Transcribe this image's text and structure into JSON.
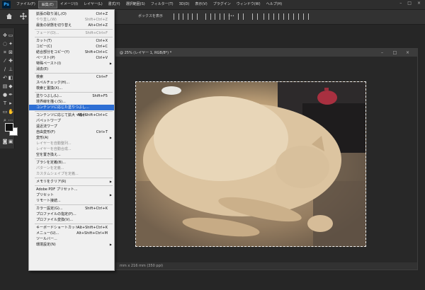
{
  "app": {
    "logo_text": "Ps",
    "accent": "#31a8ff"
  },
  "menubar": {
    "items": [
      "ファイル(F)",
      "編集(E)",
      "イメージ(I)",
      "レイヤー(L)",
      "書式(Y)",
      "選択範囲(S)",
      "フィルター(T)",
      "3D(D)",
      "表示(V)",
      "プラグイン",
      "ウィンドウ(W)",
      "ヘルプ(H)"
    ],
    "active_index": 1
  },
  "options_bar": {
    "label": "ボックスを表示"
  },
  "document": {
    "tab_title": "@ 25% (レイヤー 1, RGB/8*) *",
    "status_text": "mm x 216 mm (350 ppi)",
    "controls": [
      "minimize-icon",
      "maximize-icon",
      "close-icon"
    ]
  },
  "edit_menu": {
    "highlight_color": "#2e6fd4",
    "items": [
      {
        "type": "item",
        "label": "拡張の取り消し(O)",
        "shortcut": "Ctrl+Z",
        "disabled": false
      },
      {
        "type": "item",
        "label": "やり直し(W)",
        "shortcut": "Shift+Ctrl+Z",
        "disabled": true
      },
      {
        "type": "item",
        "label": "最後の状態を切り替え",
        "shortcut": "Alt+Ctrl+Z",
        "disabled": false
      },
      {
        "type": "sep"
      },
      {
        "type": "item",
        "label": "フェード(D)...",
        "shortcut": "Shift+Ctrl+F",
        "disabled": true
      },
      {
        "type": "sep"
      },
      {
        "type": "item",
        "label": "カット(T)",
        "shortcut": "Ctrl+X",
        "disabled": false
      },
      {
        "type": "item",
        "label": "コピー(C)",
        "shortcut": "Ctrl+C",
        "disabled": false
      },
      {
        "type": "item",
        "label": "結合部分をコピー(Y)",
        "shortcut": "Shift+Ctrl+C",
        "disabled": false
      },
      {
        "type": "item",
        "label": "ペースト(P)",
        "shortcut": "Ctrl+V",
        "disabled": false
      },
      {
        "type": "item",
        "label": "特殊ペースト(I)",
        "shortcut": "",
        "submenu": true,
        "disabled": false
      },
      {
        "type": "item",
        "label": "消去(E)",
        "shortcut": "",
        "disabled": false
      },
      {
        "type": "sep"
      },
      {
        "type": "item",
        "label": "検索",
        "shortcut": "Ctrl+F",
        "disabled": false
      },
      {
        "type": "item",
        "label": "スペルチェック(H)...",
        "shortcut": "",
        "disabled": false
      },
      {
        "type": "item",
        "label": "検索と置換(X)...",
        "shortcut": "",
        "disabled": false
      },
      {
        "type": "sep"
      },
      {
        "type": "item",
        "label": "塗りつぶし(L)...",
        "shortcut": "Shift+F5",
        "disabled": false
      },
      {
        "type": "item",
        "label": "境界線を描く(S)...",
        "shortcut": "",
        "disabled": false
      },
      {
        "type": "item",
        "label": "コンテンツに応じた塗りつぶし...",
        "shortcut": "",
        "disabled": false,
        "highlighted": true
      },
      {
        "type": "sep"
      },
      {
        "type": "item",
        "label": "コンテンツに応じて拡大・縮小",
        "shortcut": "Alt+Shift+Ctrl+C",
        "disabled": false
      },
      {
        "type": "item",
        "label": "パペットワープ",
        "shortcut": "",
        "disabled": false
      },
      {
        "type": "item",
        "label": "遠近法ワープ",
        "shortcut": "",
        "disabled": false
      },
      {
        "type": "item",
        "label": "自由変形(F)",
        "shortcut": "Ctrl+T",
        "disabled": false
      },
      {
        "type": "item",
        "label": "変形(A)",
        "shortcut": "",
        "submenu": true,
        "disabled": false
      },
      {
        "type": "item",
        "label": "レイヤーを自動整列...",
        "shortcut": "",
        "disabled": true
      },
      {
        "type": "item",
        "label": "レイヤーを自動合成...",
        "shortcut": "",
        "disabled": true
      },
      {
        "type": "item",
        "label": "空を置き換え...",
        "shortcut": "",
        "disabled": false
      },
      {
        "type": "sep"
      },
      {
        "type": "item",
        "label": "ブラシを定義(B)...",
        "shortcut": "",
        "disabled": false
      },
      {
        "type": "item",
        "label": "パターンを定義...",
        "shortcut": "",
        "disabled": true
      },
      {
        "type": "item",
        "label": "カスタムシェイプを定義...",
        "shortcut": "",
        "disabled": true
      },
      {
        "type": "sep"
      },
      {
        "type": "item",
        "label": "メモリをクリア(R)",
        "shortcut": "",
        "submenu": true,
        "disabled": false
      },
      {
        "type": "sep"
      },
      {
        "type": "item",
        "label": "Adobe PDF プリセット...",
        "shortcut": "",
        "disabled": false
      },
      {
        "type": "item",
        "label": "プリセット",
        "shortcut": "",
        "submenu": true,
        "disabled": false
      },
      {
        "type": "item",
        "label": "リモート接続...",
        "shortcut": "",
        "disabled": false
      },
      {
        "type": "sep"
      },
      {
        "type": "item",
        "label": "カラー設定(G)...",
        "shortcut": "Shift+Ctrl+K",
        "disabled": false
      },
      {
        "type": "item",
        "label": "プロファイルの指定(P)...",
        "shortcut": "",
        "disabled": false
      },
      {
        "type": "item",
        "label": "プロファイル変換(V)...",
        "shortcut": "",
        "disabled": false
      },
      {
        "type": "sep"
      },
      {
        "type": "item",
        "label": "キーボードショートカット...",
        "shortcut": "Alt+Shift+Ctrl+K",
        "disabled": false
      },
      {
        "type": "item",
        "label": "メニュー(U)...",
        "shortcut": "Alt+Shift+Ctrl+M",
        "disabled": false
      },
      {
        "type": "item",
        "label": "ツールバー...",
        "shortcut": "",
        "disabled": false
      },
      {
        "type": "item",
        "label": "環境設定(N)",
        "shortcut": "",
        "submenu": true,
        "disabled": false
      }
    ]
  }
}
